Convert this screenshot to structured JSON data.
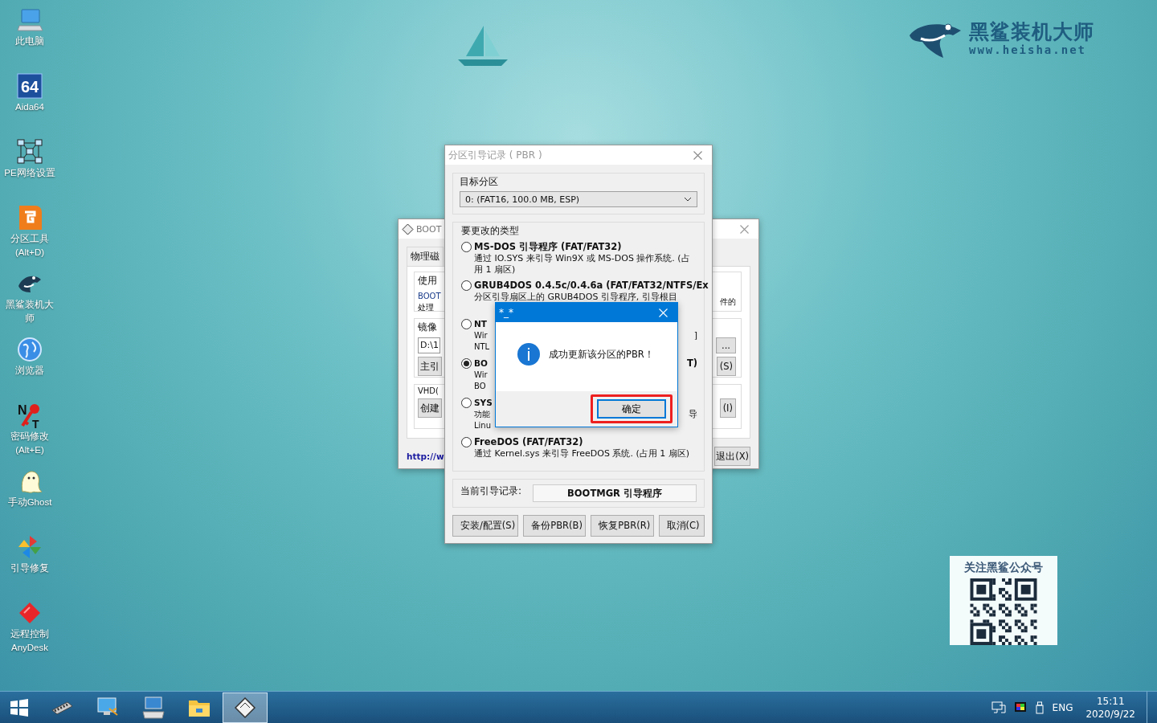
{
  "desktop_icons": [
    {
      "kind": "computer",
      "lines": [
        "此电脑"
      ]
    },
    {
      "kind": "aida",
      "lines": [
        "Aida64"
      ],
      "icon_text": [
        "64"
      ]
    },
    {
      "kind": "network",
      "lines": [
        "PE网络设置"
      ]
    },
    {
      "kind": "partition",
      "lines": [
        "分区工具",
        "(Alt+D)"
      ]
    },
    {
      "kind": "shark",
      "lines": [
        "黑鲨装机大",
        "师"
      ]
    },
    {
      "kind": "globe",
      "lines": [
        "浏览器"
      ]
    },
    {
      "kind": "key",
      "lines": [
        "密码修改",
        "(Alt+E)"
      ],
      "icon_text": [
        "N",
        "T"
      ]
    },
    {
      "kind": "ghost",
      "lines": [
        "手动Ghost"
      ]
    },
    {
      "kind": "pinwheel",
      "lines": [
        "引导修复"
      ]
    },
    {
      "kind": "anydesk",
      "lines": [
        "远程控制",
        "AnyDesk"
      ]
    }
  ],
  "logo": {
    "name": "黑鲨装机大师",
    "url": "www.heisha.net"
  },
  "qr_card": {
    "title": "关注黑鲨公众号"
  },
  "bootice_window": {
    "title": "BOOT",
    "tab": "物理磁",
    "group_1": {
      "label": "使用",
      "lines": [
        "BOOT",
        "处理"
      ],
      "right_text": "件的"
    },
    "group_2": {
      "label": "镜像",
      "field": "D:\\1",
      "browse_button": "...",
      "left_button": "主引",
      "right_button": "(S)"
    },
    "group_3": {
      "label": "VHD(",
      "left_button": "创建",
      "right_button": "(I)"
    },
    "link": "http://w",
    "exit_button": "退出(X)"
  },
  "pbr_dialog": {
    "title": "分区引导记录 ( PBR )",
    "target_label": "目标分区",
    "target_value": "0: (FAT16, 100.0 MB, ESP)",
    "type_label": "要更改的类型",
    "options": [
      {
        "kind": "full",
        "selected": false,
        "title": "MS-DOS 引导程序 (FAT/FAT32)",
        "lines": [
          "通过 IO.SYS 来引导 Win9X 或 MS-DOS 操作系统. (占",
          "用 1 扇区)"
        ]
      },
      {
        "kind": "full",
        "selected": false,
        "title": "GRUB4DOS 0.4.5c/0.4.6a (FAT/FAT32/NTFS/Ex",
        "lines": [
          "分区引导扇区上的 GRUB4DOS 引导程序, 引导根目"
        ]
      },
      {
        "kind": "covered",
        "selected": false,
        "title": "NT",
        "lines": [
          "Wir",
          "NTL"
        ],
        "right_lines": [
          "]"
        ]
      },
      {
        "kind": "covered",
        "selected": true,
        "title": "BO",
        "lines": [
          "Wir",
          "BO"
        ],
        "right_title": "T)"
      },
      {
        "kind": "covered",
        "selected": false,
        "title": "SYS",
        "lines": [
          "功能",
          "Linu"
        ],
        "right_lines": [
          "导"
        ]
      },
      {
        "kind": "full",
        "selected": false,
        "title": "FreeDOS (FAT/FAT32)",
        "lines": [
          "通过 Kernel.sys 来引导 FreeDOS 系统. (占用 1 扇区)"
        ]
      }
    ],
    "current_label": "当前引导记录:",
    "current_value": "BOOTMGR 引导程序",
    "buttons": [
      "安装/配置(S)",
      "备份PBR(B)",
      "恢复PBR(R)",
      "取消(C)"
    ]
  },
  "message_box": {
    "title": "*_*",
    "message": "成功更新该分区的PBR！",
    "button": "确定",
    "highlighted": true
  },
  "taskbar": {
    "apps": [
      {
        "kind": "memory",
        "selected": false
      },
      {
        "kind": "monitor",
        "selected": false
      },
      {
        "kind": "keyboard",
        "selected": false
      },
      {
        "kind": "folder",
        "selected": false
      },
      {
        "kind": "bootice",
        "selected": true
      }
    ],
    "language": "ENG",
    "time": "15:11",
    "date": "2020/9/22"
  }
}
